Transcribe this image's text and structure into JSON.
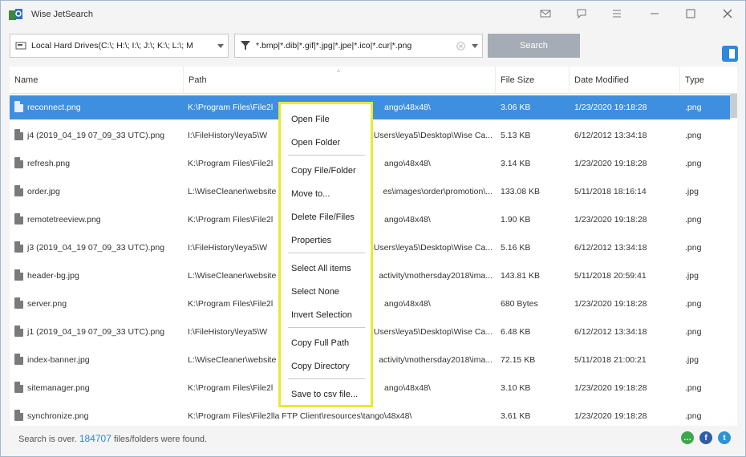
{
  "app": {
    "title": "Wise JetSearch"
  },
  "titlebar_buttons": [
    "mail-icon",
    "feedback-icon",
    "menu-icon",
    "minimize-icon",
    "maximize-icon",
    "close-icon"
  ],
  "toolbar": {
    "location": "Local Hard Drives(C:\\; H:\\; I:\\; J:\\; K:\\; L:\\; M",
    "filter": "*.bmp|*.dib|*.gif|*.jpg|*.jpe|*.ico|*.cur|*.png",
    "search_label": "Search"
  },
  "table": {
    "columns": [
      "Name",
      "Path",
      "File Size",
      "Date Modified",
      "Type"
    ],
    "rows": [
      {
        "name": "reconnect.png",
        "path": "K:\\Program Files\\File2l",
        "path2": "ango\\48x48\\",
        "size": "3.06 KB",
        "date": "1/23/2020 19:18:28",
        "type": ".png"
      },
      {
        "name": "j4 (2019_04_19 07_09_33 UTC).png",
        "path": "I:\\FileHistory\\leya5\\W",
        "path2": "Users\\leya5\\Desktop\\Wise Ca...",
        "size": "5.13 KB",
        "date": "6/12/2012 13:34:18",
        "type": ".png"
      },
      {
        "name": "refresh.png",
        "path": "K:\\Program Files\\File2l",
        "path2": "ango\\48x48\\",
        "size": "3.14 KB",
        "date": "1/23/2020 19:18:28",
        "type": ".png"
      },
      {
        "name": "order.jpg",
        "path": "L:\\WiseCleaner\\website",
        "path2": "es\\images\\order\\promotion\\...",
        "size": "133.08 KB",
        "date": "5/11/2018 18:16:14",
        "type": ".jpg"
      },
      {
        "name": "remotetreeview.png",
        "path": "K:\\Program Files\\File2l",
        "path2": "ango\\48x48\\",
        "size": "1.90 KB",
        "date": "1/23/2020 19:18:28",
        "type": ".png"
      },
      {
        "name": "j3 (2019_04_19 07_09_33 UTC).png",
        "path": "I:\\FileHistory\\leya5\\W",
        "path2": "Users\\leya5\\Desktop\\Wise Ca...",
        "size": "5.16 KB",
        "date": "6/12/2012 13:34:18",
        "type": ".png"
      },
      {
        "name": "header-bg.jpg",
        "path": "L:\\WiseCleaner\\website",
        "path2": "activity\\mothersday2018\\ima...",
        "size": "143.81 KB",
        "date": "5/11/2018 20:59:41",
        "type": ".jpg"
      },
      {
        "name": "server.png",
        "path": "K:\\Program Files\\File2l",
        "path2": "ango\\48x48\\",
        "size": "680 Bytes",
        "date": "1/23/2020 19:18:28",
        "type": ".png"
      },
      {
        "name": "j1 (2019_04_19 07_09_33 UTC).png",
        "path": "I:\\FileHistory\\leya5\\W",
        "path2": "Users\\leya5\\Desktop\\Wise Ca...",
        "size": "6.48 KB",
        "date": "6/12/2012 13:34:18",
        "type": ".png"
      },
      {
        "name": "index-banner.jpg",
        "path": "L:\\WiseCleaner\\website",
        "path2": "activity\\mothersday2018\\ima...",
        "size": "72.15 KB",
        "date": "5/11/2018 21:00:21",
        "type": ".jpg"
      },
      {
        "name": "sitemanager.png",
        "path": "K:\\Program Files\\File2l",
        "path2": "ango\\48x48\\",
        "size": "3.10 KB",
        "date": "1/23/2020 19:18:28",
        "type": ".png"
      },
      {
        "name": "synchronize.png",
        "path": "K:\\Program Files\\File2lla FTP Client\\resources\\tango\\48x48\\",
        "path2": "",
        "size": "3.61 KB",
        "date": "1/23/2020 19:18:28",
        "type": ".png"
      }
    ]
  },
  "context_menu": {
    "groups": [
      [
        "Open File",
        "Open Folder"
      ],
      [
        "Copy File/Folder",
        "Move to...",
        "Delete File/Files",
        "Properties"
      ],
      [
        "Select All items",
        "Select None",
        "Invert Selection"
      ],
      [
        "Copy Full Path",
        "Copy Directory"
      ],
      [
        "Save to csv file..."
      ]
    ]
  },
  "status": {
    "prefix": "Search is over.",
    "count": "184707",
    "suffix": "files/folders were found."
  },
  "social": [
    "chat-icon",
    "facebook-icon",
    "twitter-icon"
  ],
  "colors": {
    "accent": "#3e8fe0",
    "highlight_border": "#ece832",
    "search_button": "#a6acb5"
  }
}
